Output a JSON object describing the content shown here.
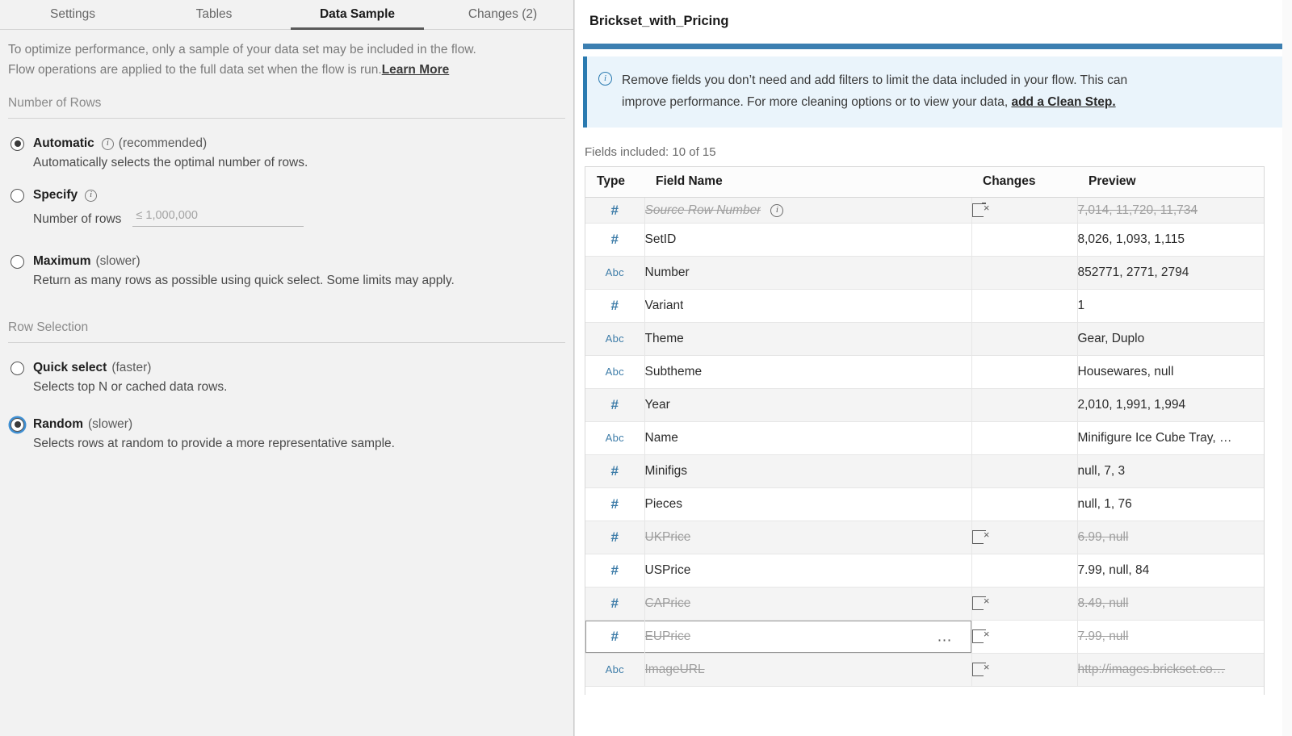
{
  "tabs": [
    {
      "label": "Settings",
      "active": false
    },
    {
      "label": "Tables",
      "active": false
    },
    {
      "label": "Data Sample",
      "active": true
    },
    {
      "label": "Changes (2)",
      "active": false
    }
  ],
  "intro": {
    "line1": "To optimize performance, only a sample of your data set may be included in the flow.",
    "line2": "Flow operations are applied to the full data set when the flow is run.",
    "link": "Learn More"
  },
  "number_of_rows": {
    "section_title": "Number of Rows",
    "automatic": {
      "label": "Automatic",
      "suffix": "(recommended)",
      "description": "Automatically selects the optimal number of rows.",
      "selected": true,
      "info_icon": "info-icon"
    },
    "specify": {
      "label": "Specify",
      "selected": false,
      "info_icon": "info-icon",
      "field_label": "Number of rows",
      "field_value": "",
      "field_placeholder": "≤ 1,000,000"
    },
    "maximum": {
      "label": "Maximum",
      "suffix": "(slower)",
      "description": "Return as many rows as possible using quick select. Some limits may apply.",
      "selected": false
    }
  },
  "row_selection": {
    "section_title": "Row Selection",
    "quick_select": {
      "label": "Quick select",
      "suffix": "(faster)",
      "description": "Selects top N or cached data rows.",
      "selected": false
    },
    "random": {
      "label": "Random",
      "suffix": "(slower)",
      "description": "Selects rows at random to provide a more representative sample.",
      "selected": true,
      "focused": true
    }
  },
  "right": {
    "title": "Brickset_with_Pricing",
    "notice": {
      "icon": "info-circle-icon",
      "line1": "Remove fields you don’t need and add filters to limit the data included in your flow. This can",
      "line2": "improve performance. For more cleaning options or to view your data,",
      "link": "add a Clean Step."
    },
    "fields_count": "Fields included: 10 of 15",
    "accent_color": "#3c7fb1",
    "notice_bg": "#eaf4fb",
    "columns": [
      "Type",
      "Field Name",
      "Changes",
      "Preview"
    ],
    "rows": [
      {
        "type": "#",
        "name": "Source Row Number",
        "changes": "remove-field-icon",
        "preview": "7,014, 11,720, 11,734",
        "removed": true,
        "italic": true,
        "info": true,
        "hovered": false,
        "zebra": true
      },
      {
        "type": "#",
        "name": "SetID",
        "changes": "",
        "preview": "8,026, 1,093, 1,115",
        "removed": false,
        "italic": false,
        "info": false,
        "hovered": false,
        "zebra": false
      },
      {
        "type": "Abc",
        "name": "Number",
        "changes": "",
        "preview": "852771, 2771, 2794",
        "removed": false,
        "italic": false,
        "info": false,
        "hovered": false,
        "zebra": true
      },
      {
        "type": "#",
        "name": "Variant",
        "changes": "",
        "preview": "1",
        "removed": false,
        "italic": false,
        "info": false,
        "hovered": false,
        "zebra": false
      },
      {
        "type": "Abc",
        "name": "Theme",
        "changes": "",
        "preview": "Gear, Duplo",
        "removed": false,
        "italic": false,
        "info": false,
        "hovered": false,
        "zebra": true
      },
      {
        "type": "Abc",
        "name": "Subtheme",
        "changes": "",
        "preview": "Housewares, null",
        "removed": false,
        "italic": false,
        "info": false,
        "hovered": false,
        "zebra": false
      },
      {
        "type": "#",
        "name": "Year",
        "changes": "",
        "preview": "2,010, 1,991, 1,994",
        "removed": false,
        "italic": false,
        "info": false,
        "hovered": false,
        "zebra": true
      },
      {
        "type": "Abc",
        "name": "Name",
        "changes": "",
        "preview": "Minifigure Ice Cube Tray, …",
        "removed": false,
        "italic": false,
        "info": false,
        "hovered": false,
        "zebra": false
      },
      {
        "type": "#",
        "name": "Minifigs",
        "changes": "",
        "preview": "null, 7, 3",
        "removed": false,
        "italic": false,
        "info": false,
        "hovered": false,
        "zebra": true
      },
      {
        "type": "#",
        "name": "Pieces",
        "changes": "",
        "preview": "null, 1, 76",
        "removed": false,
        "italic": false,
        "info": false,
        "hovered": false,
        "zebra": false
      },
      {
        "type": "#",
        "name": "UKPrice",
        "changes": "remove-field-icon",
        "preview": "6.99, null",
        "removed": true,
        "italic": false,
        "info": false,
        "hovered": false,
        "zebra": true
      },
      {
        "type": "#",
        "name": "USPrice",
        "changes": "",
        "preview": "7.99, null, 84",
        "removed": false,
        "italic": false,
        "info": false,
        "hovered": false,
        "zebra": false
      },
      {
        "type": "#",
        "name": "CAPrice",
        "changes": "remove-field-icon",
        "preview": "8.49, null",
        "removed": true,
        "italic": false,
        "info": false,
        "hovered": false,
        "zebra": true
      },
      {
        "type": "#",
        "name": "EUPrice",
        "changes": "remove-field-icon",
        "preview": "7.99, null",
        "removed": true,
        "italic": false,
        "info": false,
        "hovered": true,
        "zebra": false,
        "menu": "…"
      },
      {
        "type": "Abc",
        "name": "ImageURL",
        "changes": "remove-field-icon",
        "preview": "http://images.brickset.co…",
        "removed": true,
        "italic": false,
        "info": false,
        "hovered": false,
        "zebra": true
      }
    ]
  }
}
